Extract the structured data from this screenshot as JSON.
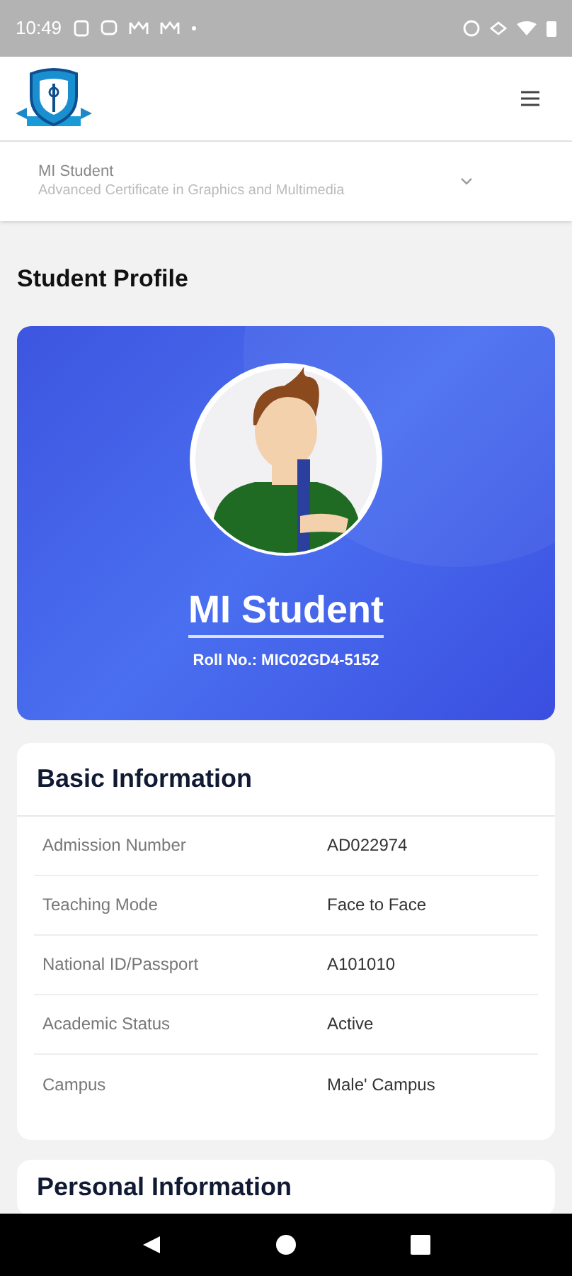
{
  "status_bar": {
    "time": "10:49"
  },
  "program_selector": {
    "name": "MI Student",
    "program": "Advanced Certificate in Graphics and Multimedia"
  },
  "page_title": "Student Profile",
  "profile_card": {
    "name": "MI Student",
    "roll": "Roll No.: MIC02GD4-5152"
  },
  "basic_information": {
    "title": "Basic Information",
    "rows": [
      {
        "label": "Admission Number",
        "value": "AD022974"
      },
      {
        "label": "Teaching Mode",
        "value": "Face to Face"
      },
      {
        "label": "National ID/Passport",
        "value": "A101010"
      },
      {
        "label": "Academic Status",
        "value": "Active"
      },
      {
        "label": "Campus",
        "value": "Male' Campus"
      }
    ]
  },
  "personal_information": {
    "title": "Personal Information"
  }
}
